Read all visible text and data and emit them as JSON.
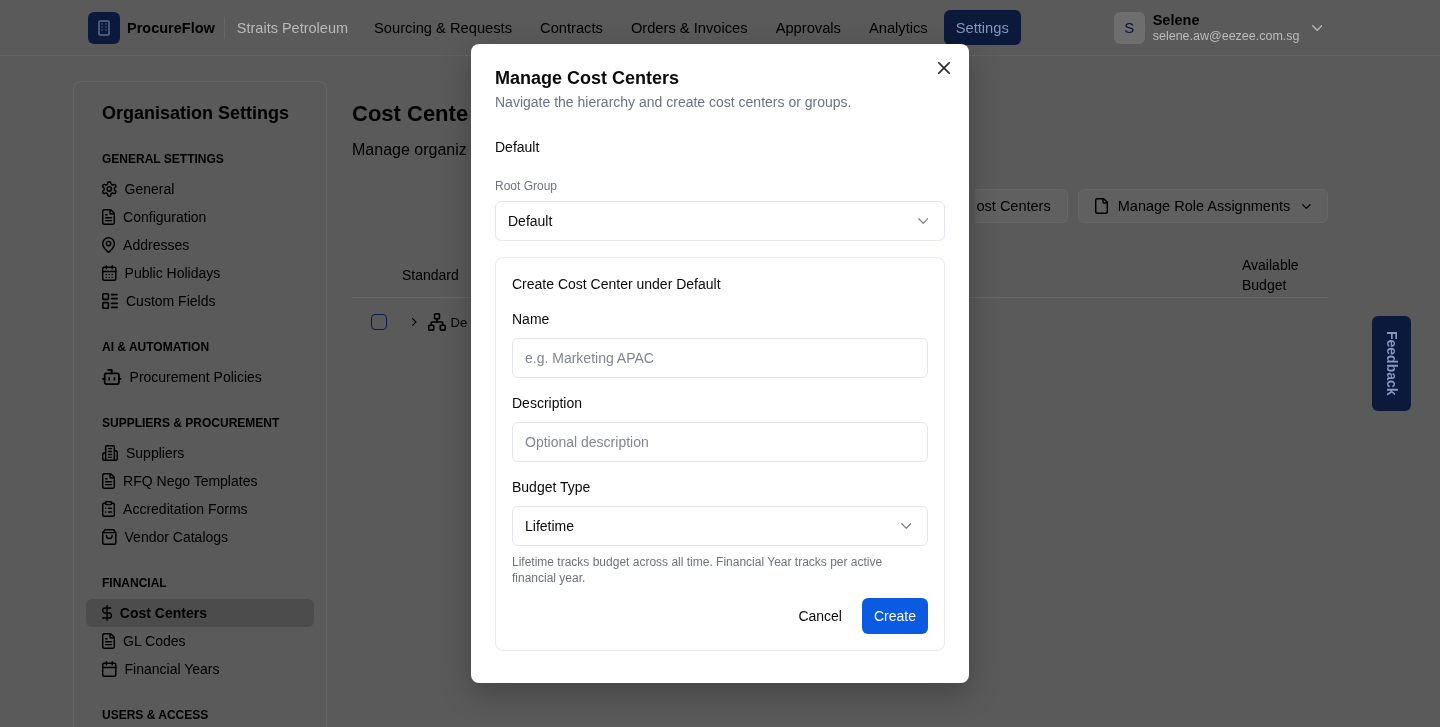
{
  "top_bar": {
    "brand": "ProcureFlow",
    "organization": "Straits Petroleum",
    "nav": [
      {
        "label": "Sourcing & Requests",
        "selected": false
      },
      {
        "label": "Contracts",
        "selected": false
      },
      {
        "label": "Orders & Invoices",
        "selected": false
      },
      {
        "label": "Approvals",
        "selected": false
      },
      {
        "label": "Analytics",
        "selected": false
      },
      {
        "label": "Settings",
        "selected": true
      }
    ],
    "user": {
      "initial": "S",
      "name": "Selene",
      "email": "selene.aw@eezee.com.sg"
    }
  },
  "sidebar": {
    "title": "Organisation Settings",
    "sections": [
      {
        "heading": "GENERAL SETTINGS",
        "items": [
          {
            "label": "General",
            "selected": false
          },
          {
            "label": "Configuration",
            "selected": false
          },
          {
            "label": "Addresses",
            "selected": false
          },
          {
            "label": "Public Holidays",
            "selected": false
          },
          {
            "label": "Custom Fields",
            "selected": false
          }
        ]
      },
      {
        "heading": "AI & AUTOMATION",
        "items": [
          {
            "label": "Procurement Policies",
            "selected": false
          }
        ]
      },
      {
        "heading": "SUPPLIERS & PROCUREMENT",
        "items": [
          {
            "label": "Suppliers",
            "selected": false
          },
          {
            "label": "RFQ Nego Templates",
            "selected": false
          },
          {
            "label": "Accreditation Forms",
            "selected": false
          },
          {
            "label": "Vendor Catalogs",
            "selected": false
          }
        ]
      },
      {
        "heading": "FINANCIAL",
        "items": [
          {
            "label": "Cost Centers",
            "selected": true
          },
          {
            "label": "GL Codes",
            "selected": false
          },
          {
            "label": "Financial Years",
            "selected": false
          }
        ]
      },
      {
        "heading": "USERS & ACCESS"
      }
    ]
  },
  "main": {
    "title": "Cost Cente",
    "subtitle": "Manage organiz",
    "toolbar": [
      {
        "kind": "text",
        "label": "ost Centers"
      },
      {
        "kind": "dropdown",
        "label": "Manage Role Assignments"
      }
    ],
    "table": {
      "columns": [
        {
          "label": "Standard"
        },
        {
          "label": "Available Budget"
        }
      ],
      "rows": [
        {
          "checked": false,
          "expanded": false,
          "name": "De"
        }
      ]
    }
  },
  "feedback_tab": {
    "label": "Feedback"
  },
  "dialog": {
    "title": "Manage Cost Centers",
    "subtitle": "Navigate the hierarchy and create cost centers or groups.",
    "breadcrumb": "Default",
    "root_group": {
      "label": "Root Group",
      "value": "Default"
    },
    "form": {
      "title": "Create Cost Center under Default",
      "fields": [
        {
          "kind": "text",
          "label": "Name",
          "placeholder": "e.g. Marketing APAC"
        },
        {
          "kind": "text",
          "label": "Description",
          "placeholder": "Optional description"
        },
        {
          "kind": "select",
          "label": "Budget Type",
          "value": "Lifetime",
          "help": "Lifetime tracks budget across all time. Financial Year tracks per active financial year."
        }
      ],
      "buttons": [
        {
          "kind": "secondary",
          "label": "Cancel"
        },
        {
          "kind": "primary",
          "label": "Create"
        }
      ]
    }
  }
}
